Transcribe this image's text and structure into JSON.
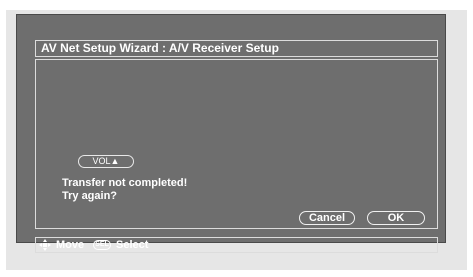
{
  "title": "AV Net Setup Wizard : A/V Receiver Setup",
  "vol_button": {
    "label": "VOL▲"
  },
  "message": {
    "line1": "Transfer not completed!",
    "line2": "Try again?"
  },
  "buttons": {
    "cancel": "Cancel",
    "ok": "OK"
  },
  "status_bar": {
    "nav_icon": "four-way-arrow-icon",
    "move_label": "Move",
    "sel_key": "SEL",
    "select_label": "Select"
  },
  "colors": {
    "screen_bg": "#6e6e6e",
    "frame_bg": "#e6e6e6",
    "text": "#ffffff"
  }
}
